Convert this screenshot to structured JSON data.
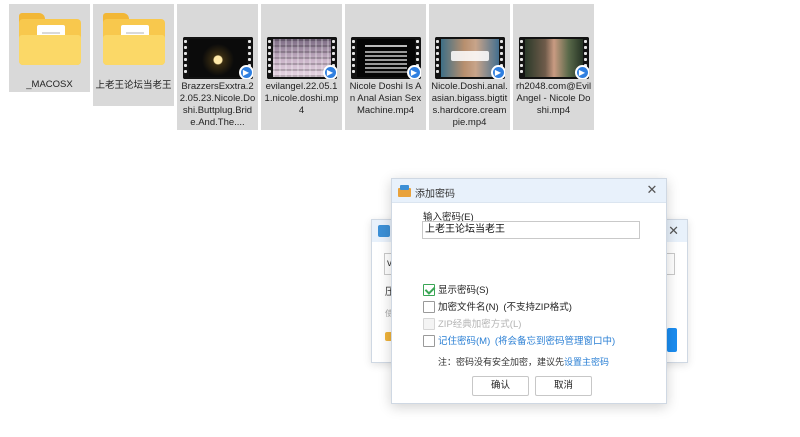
{
  "files": [
    {
      "name": "_MACOSX",
      "kind": "folder"
    },
    {
      "name": "上老王论坛当老王",
      "kind": "folder"
    },
    {
      "name": "BrazzersExxtra.22.05.23.Nicole.Doshi.Buttplug.Bride.And.The....",
      "kind": "video"
    },
    {
      "name": "evilangel.22.05.11.nicole.doshi.mp4",
      "kind": "video"
    },
    {
      "name": "Nicole Doshi Is An Anal Asian Sex Machine.mp4",
      "kind": "video"
    },
    {
      "name": "Nicole.Doshi.anal.asian.bigass.bigtits.hardcore.creampie.mp4",
      "kind": "video"
    },
    {
      "name": "rh2048.com@Evil Angel - Nicole Doshi.mp4",
      "kind": "video"
    }
  ],
  "back_dialog": {
    "field_text": "v",
    "line1_text": "压",
    "line2_text": "使"
  },
  "dialog": {
    "title": "添加密码",
    "close_symbol": "✕",
    "password_label": "输入密码(E)",
    "password_value": "上老王论坛当老王",
    "options": {
      "show_password": {
        "label": "显示密码(S)",
        "checked": true
      },
      "encrypt_filenames": {
        "label": "加密文件名(N)",
        "extra": "(不支持ZIP格式)",
        "checked": false
      },
      "zip_classic": {
        "label": "ZIP经典加密方式(L)",
        "checked": false,
        "disabled": true
      },
      "remember_password": {
        "label": "记住密码(M)",
        "extra": "(将会备忘到密码管理窗口中)",
        "checked": false
      }
    },
    "note_text": "注：密码没有安全加密，建议先",
    "note_link": "设置主密码",
    "ok_label": "确认",
    "cancel_label": "取消"
  },
  "colors": {
    "tile_bg": "#d9d9d9",
    "titlebar_bg": "#e8f1fb",
    "accent_blue": "#2a7fd4",
    "check_green": "#3aa655"
  }
}
